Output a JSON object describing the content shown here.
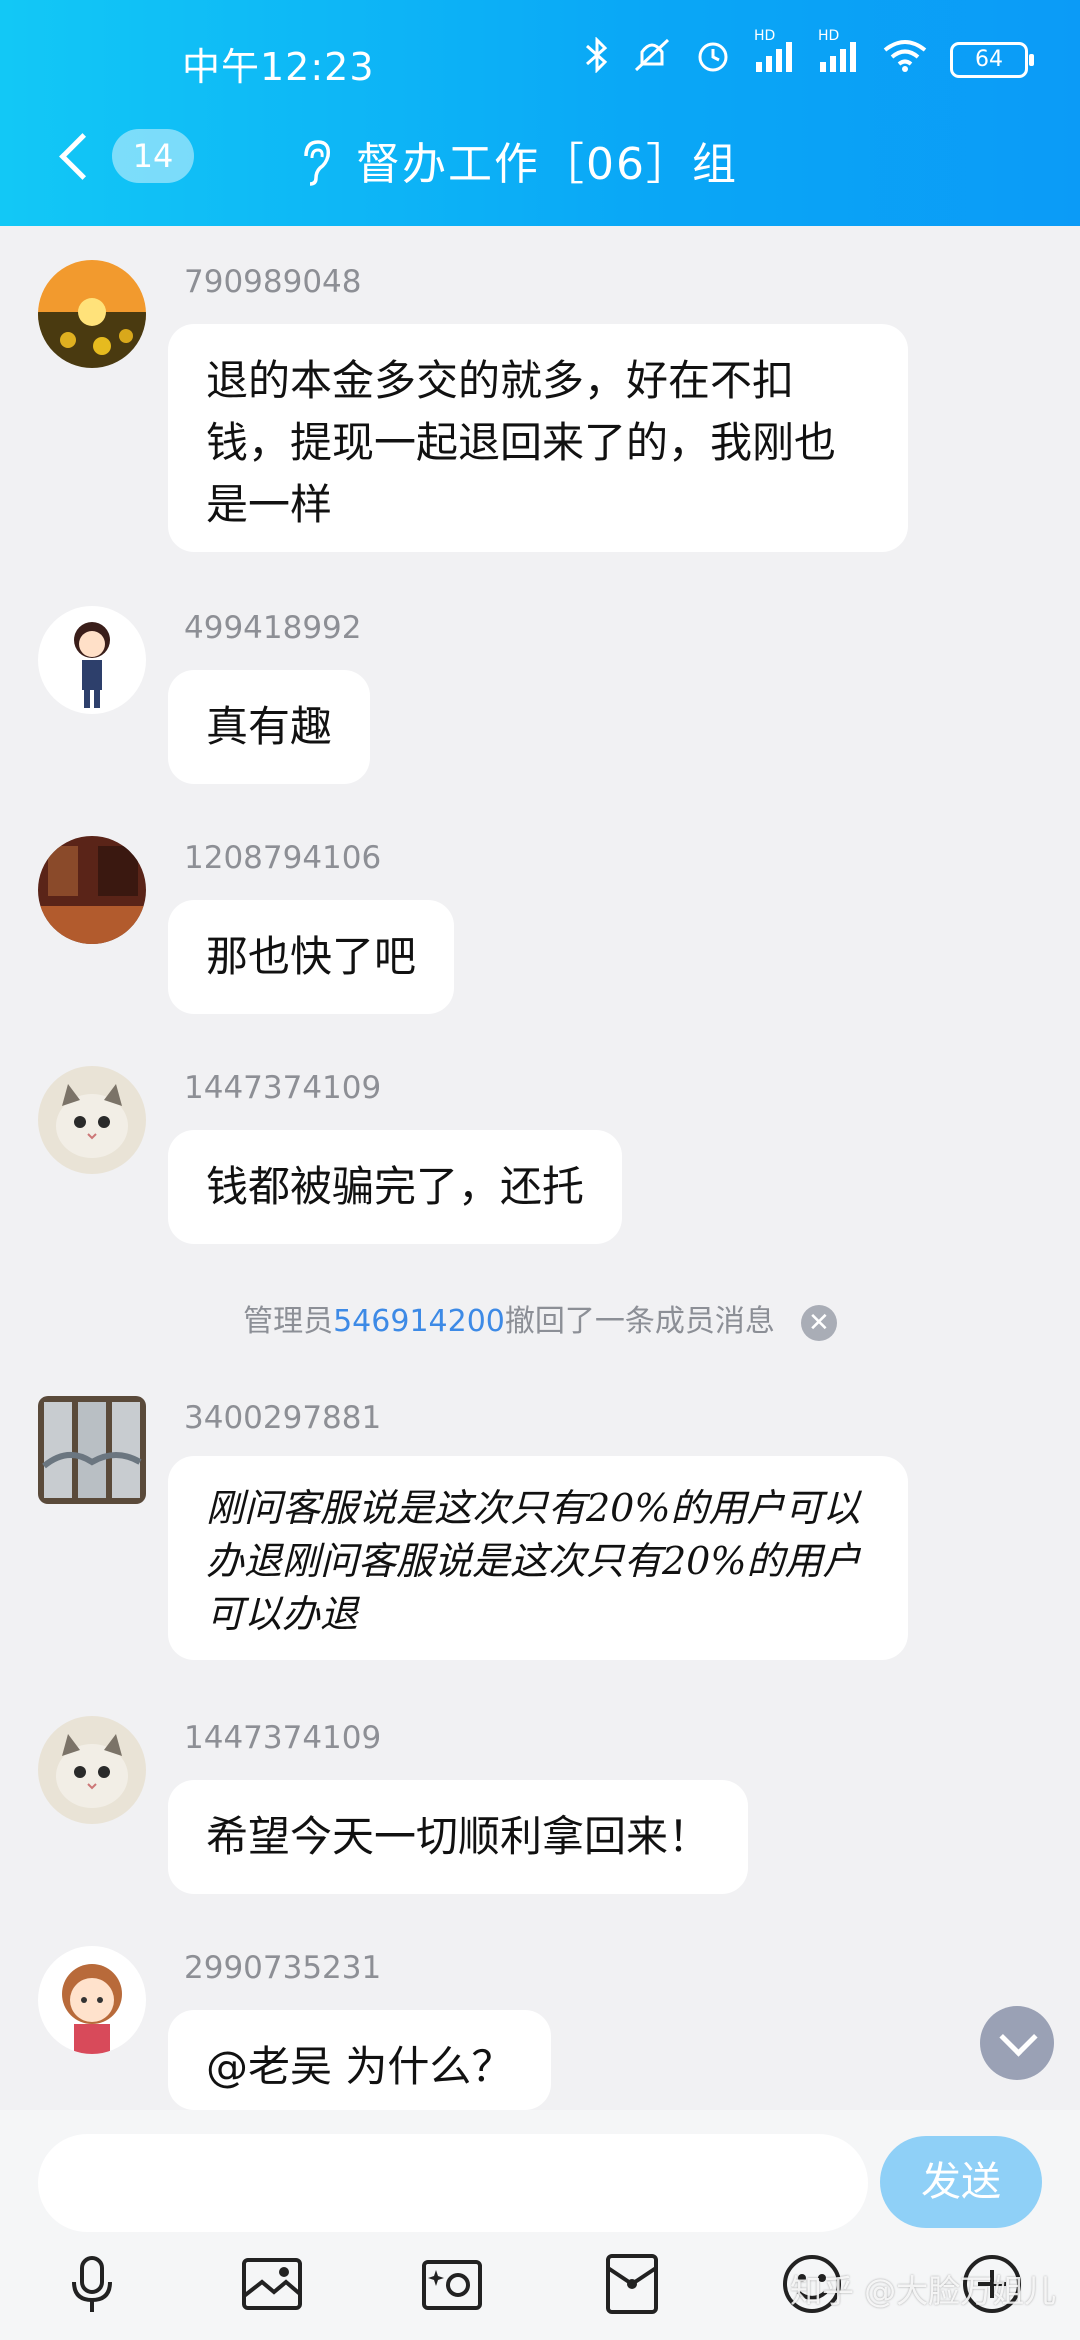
{
  "status": {
    "time": "中午12:23",
    "battery": "64",
    "net1": "HD",
    "net2": "HD"
  },
  "header": {
    "unread_count": "14",
    "title": "督办工作［06］组"
  },
  "messages": [
    {
      "sender": "790989048",
      "text": "退的本金多交的就多，好在不扣钱，提现一起退回来了的，我刚也是一样"
    },
    {
      "sender": "499418992",
      "text": "真有趣"
    },
    {
      "sender": "1208794106",
      "text": "那也快了吧"
    },
    {
      "sender": "1447374109",
      "text": "钱都被骗完了，还托"
    },
    {
      "sender": "3400297881",
      "text": "刚问客服说是这次只有20%的用户可以办退刚问客服说是这次只有20%的用户可以办退"
    },
    {
      "sender": "1447374109",
      "text": "希望今天一切顺利拿回来！"
    },
    {
      "sender": "2990735231",
      "text": "@老吴 为什么？"
    }
  ],
  "system_notice": {
    "prefix": "管理员",
    "admin_id": "546914200",
    "suffix": "撤回了一条成员消息",
    "close": "✕"
  },
  "composer": {
    "send_label": "发送"
  },
  "toolbar_icons": [
    "microphone-icon",
    "image-icon",
    "camera-icon",
    "red-packet-icon",
    "emoji-icon",
    "plus-icon"
  ],
  "watermark": "知乎 @大脸万姐儿"
}
